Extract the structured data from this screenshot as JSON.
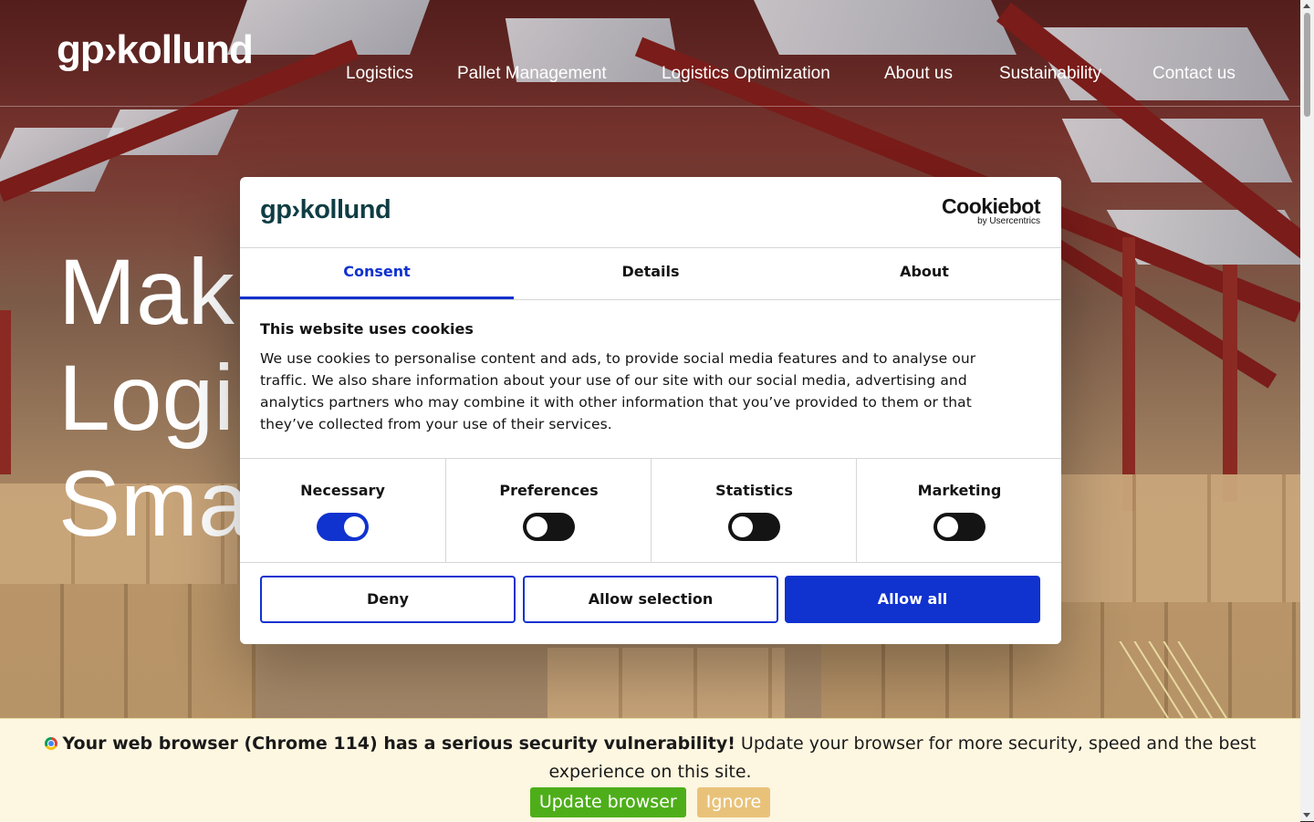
{
  "site": {
    "logo_text": "gp›kollund",
    "nav": [
      {
        "label": "Logistics"
      },
      {
        "label": "Pallet Management"
      },
      {
        "label": "Logistics Optimization"
      },
      {
        "label": "About us"
      },
      {
        "label": "Sustainability"
      },
      {
        "label": "Contact us"
      }
    ],
    "headline_lines": [
      "Mak",
      "Logi",
      "Sma"
    ]
  },
  "cookie_dialog": {
    "logo_text": "gp›kollund",
    "provider_main": "Cookiebot",
    "provider_sub": "by Usercentrics",
    "tabs": [
      {
        "label": "Consent",
        "active": true
      },
      {
        "label": "Details",
        "active": false
      },
      {
        "label": "About",
        "active": false
      }
    ],
    "title": "This website uses cookies",
    "text": "We use cookies to personalise content and ads, to provide social media features and to analyse our traffic. We also share information about your use of our site with our social media, advertising and analytics partners who may combine it with other information that you’ve provided to them or that they’ve collected from your use of their services.",
    "toggles": [
      {
        "label": "Necessary",
        "on": true
      },
      {
        "label": "Preferences",
        "on": false
      },
      {
        "label": "Statistics",
        "on": false
      },
      {
        "label": "Marketing",
        "on": false
      }
    ],
    "buttons": {
      "deny": "Deny",
      "allow_selection": "Allow selection",
      "allow_all": "Allow all"
    },
    "accent_color": "#1032cf"
  },
  "update_bar": {
    "bold_text": "Your web browser (Chrome 114) has a serious security vulnerability!",
    "text": "Update your browser for more security, speed and the best experience on this site.",
    "update_label": "Update browser",
    "ignore_label": "Ignore",
    "icon": "chrome-icon"
  }
}
